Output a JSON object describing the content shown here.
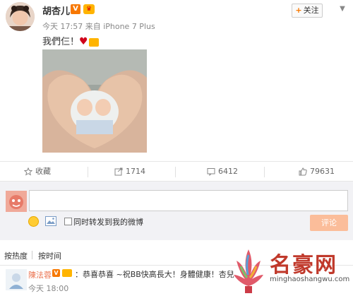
{
  "post": {
    "username": "胡杏儿",
    "verified_badge": "V",
    "meta": "今天 17:57 来自 iPhone 7 Plus",
    "text": "我們仨！",
    "follow_label": "关注",
    "heart_icon": "heart-icon"
  },
  "actions": {
    "favorite_label": "收藏",
    "repost_count": "1714",
    "comment_count": "6412",
    "like_count": "79631"
  },
  "composer": {
    "input_placeholder": "",
    "repost_option": "同时转发到我的微博",
    "submit_label": "评论"
  },
  "sort": {
    "hot": "按热度",
    "time": "按时间"
  },
  "comment": {
    "name": "陳法蓉",
    "verified_badge": "V",
    "text": "：恭喜恭喜 ~祝BB快高長大！身體健康！杏兒",
    "time": "今天 18:00"
  },
  "watermark": {
    "brand": "名豪网",
    "url": "minghaoshangwu.com"
  },
  "colors": {
    "accent": "#f77800",
    "comment_name": "#eb7350",
    "submit_bg": "#fbbd9a",
    "composer_bg": "#f2f2f5"
  }
}
